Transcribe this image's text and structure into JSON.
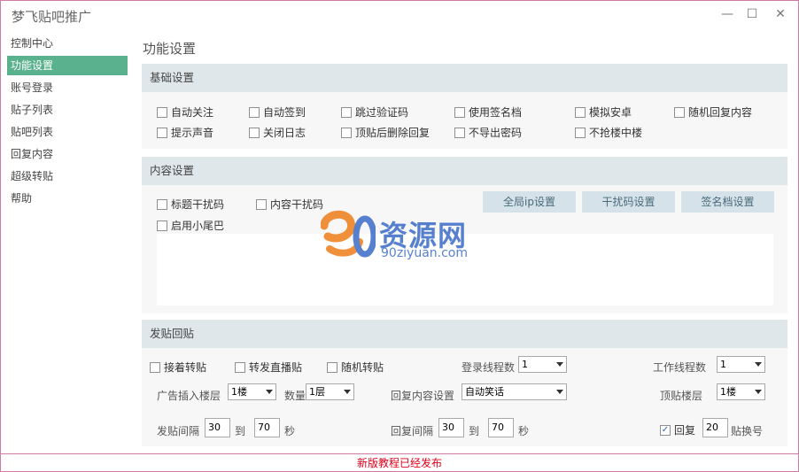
{
  "app": {
    "title": "梦飞贴吧推广",
    "minimize": "—",
    "maximize": "☐",
    "close": "✕"
  },
  "sidebar": {
    "items": [
      {
        "label": "控制中心",
        "active": false
      },
      {
        "label": "功能设置",
        "active": true
      },
      {
        "label": "账号登录",
        "active": false
      },
      {
        "label": "贴子列表",
        "active": false
      },
      {
        "label": "贴吧列表",
        "active": false
      },
      {
        "label": "回复内容",
        "active": false
      },
      {
        "label": "超级转贴",
        "active": false
      },
      {
        "label": "帮助",
        "active": false
      }
    ]
  },
  "main": {
    "page_title": "功能设置",
    "basic": {
      "header": "基础设置",
      "options": [
        {
          "label": "自动关注",
          "checked": false
        },
        {
          "label": "自动签到",
          "checked": false
        },
        {
          "label": "跳过验证码",
          "checked": false
        },
        {
          "label": "使用签名档",
          "checked": false
        },
        {
          "label": "模拟安卓",
          "checked": false
        },
        {
          "label": "随机回复内容",
          "checked": false
        },
        {
          "label": "提示声音",
          "checked": false
        },
        {
          "label": "关闭日志",
          "checked": false
        },
        {
          "label": "顶贴后删除回复",
          "checked": false
        },
        {
          "label": "不导出密码",
          "checked": false
        },
        {
          "label": "不抢楼中楼",
          "checked": false
        }
      ]
    },
    "content": {
      "header": "内容设置",
      "options": [
        {
          "label": "标题干扰码",
          "checked": false
        },
        {
          "label": "内容干扰码",
          "checked": false
        },
        {
          "label": "启用小尾巴",
          "checked": false
        }
      ],
      "buttons": {
        "global_ip": "全局ip设置",
        "interfere": "干扰码设置",
        "signature": "签名档设置"
      },
      "textarea_value": ""
    },
    "posting": {
      "header": "发贴回贴",
      "options": [
        {
          "label": "接着转贴",
          "checked": false
        },
        {
          "label": "转发直播贴",
          "checked": false
        },
        {
          "label": "随机转贴",
          "checked": false
        }
      ],
      "login_threads": {
        "label": "登录线程数",
        "value": "1"
      },
      "work_threads": {
        "label": "工作线程数",
        "value": "1"
      },
      "ad_floor": {
        "label": "广告插入楼层",
        "value": "1楼"
      },
      "count": {
        "label": "数量",
        "value": "1层"
      },
      "reply_content": {
        "label": "回复内容设置",
        "value": "自动笑话"
      },
      "bump_floor": {
        "label": "顶贴楼层",
        "value": "1楼"
      },
      "post_interval": {
        "label": "发贴间隔",
        "from": "30",
        "to_label": "到",
        "to": "70",
        "unit": "秒"
      },
      "reply_interval": {
        "label": "回复间隔",
        "from": "30",
        "to_label": "到",
        "to": "70",
        "unit": "秒"
      },
      "reply_switch": {
        "label": "回复",
        "checked": true,
        "value": "20",
        "suffix": "贴换号"
      }
    }
  },
  "watermark": {
    "brand": "资源网",
    "site": "90ziyuan.com"
  },
  "status": {
    "text": "新版教程已经发布"
  },
  "colors": {
    "accent": "#5ab18e",
    "panel_header": "#dfe7ea",
    "button_bg": "#d5e2ea",
    "status_text": "#e0001a",
    "window_border": "#d07aa6"
  }
}
